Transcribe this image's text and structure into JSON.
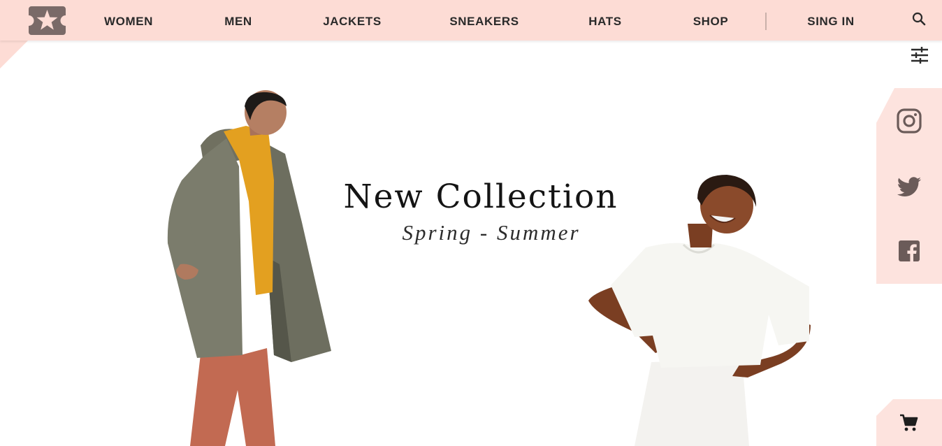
{
  "brand": {
    "logo_icon": "star-ticket-icon",
    "logo_color": "#7a6a68"
  },
  "header": {
    "background": "#fddcd5",
    "nav": [
      "WOMEN",
      "MEN",
      "JACKETS",
      "SNEAKERS",
      "HATS",
      "SHOP"
    ],
    "sign_in_label": "SING IN",
    "search_icon": "search-icon"
  },
  "toolbar": {
    "filter_icon": "sliders-icon"
  },
  "hero": {
    "title": "New Collection",
    "subtitle": "Spring - Summer"
  },
  "social": {
    "background": "#fde3de",
    "links": [
      "instagram-icon",
      "twitter-icon",
      "facebook-icon"
    ],
    "icon_color": "#6b5b59"
  },
  "cart": {
    "icon": "cart-icon"
  }
}
